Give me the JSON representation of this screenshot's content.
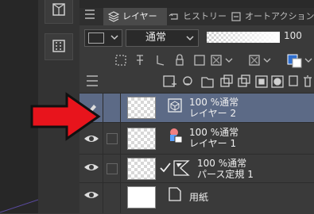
{
  "tabs": {
    "layer": "レイヤー",
    "history": "ヒストリー",
    "autoaction": "オートアクション"
  },
  "blend_mode": "通常",
  "opacity_value": "100",
  "layers": [
    {
      "opacity_mode": "100 %通常",
      "name": "レイヤー 2",
      "selected": true
    },
    {
      "opacity_mode": "100 %通常",
      "name": "レイヤー 1"
    },
    {
      "opacity_mode": "100 %通常",
      "name": "パース定規 1"
    },
    {
      "name": "用紙"
    }
  ],
  "colors": {
    "selected_row": "#5c6a86",
    "arrow": "#e8141c"
  },
  "icons": [
    "layer-stack-icon",
    "menu-icon",
    "eye-icon",
    "pencil-icon",
    "checkmark-icon",
    "ruler-icon",
    "new-layer-icon",
    "trash-icon"
  ]
}
